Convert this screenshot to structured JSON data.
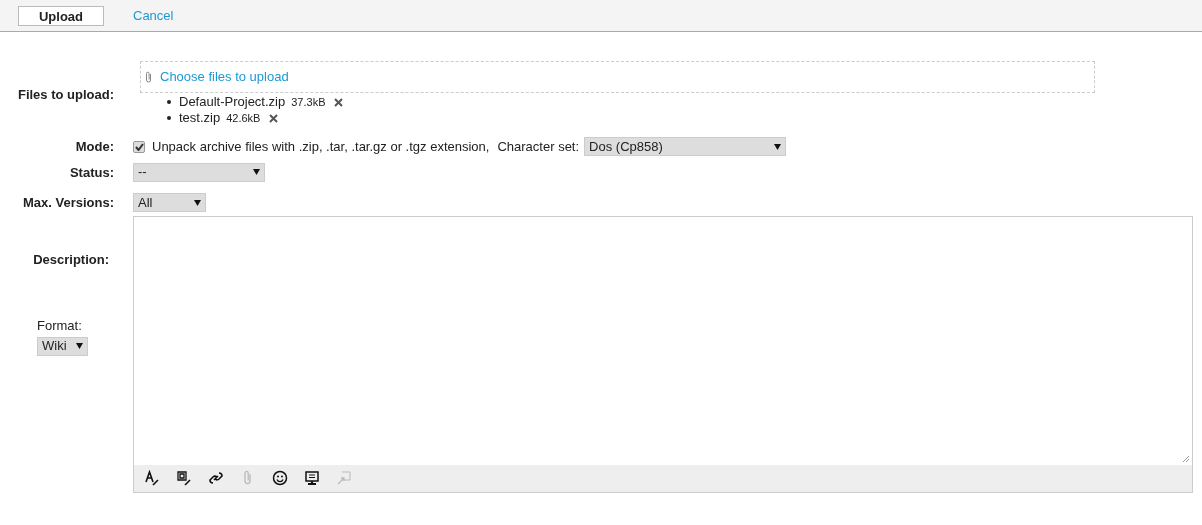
{
  "header": {
    "buttons": [
      {
        "label": "Upload",
        "kind": "button"
      },
      {
        "label": "Cancel",
        "kind": "link"
      }
    ]
  },
  "files": {
    "label": "Files to upload:",
    "chooser": "Choose files to upload",
    "items": [
      {
        "name": "Default-Project.zip",
        "size": "37.3kB"
      },
      {
        "name": "test.zip",
        "size": "42.6kB"
      }
    ]
  },
  "mode": {
    "label": "Mode:",
    "checked": true,
    "text": "Unpack archive files with .zip, .tar, .tar.gz or .tgz extension,",
    "charset_label": "Character set:",
    "charset": "Dos (Cp858)"
  },
  "status": {
    "label": "Status:",
    "value": "--"
  },
  "max_versions": {
    "label": "Max. Versions:",
    "value": "All"
  },
  "description": {
    "label": "Description:",
    "format_label": "Format:",
    "format": "Wiki",
    "toolbar": [
      {
        "kind": "text",
        "disabled": false
      },
      {
        "kind": "box",
        "disabled": false
      },
      {
        "kind": "link",
        "disabled": false
      },
      {
        "kind": "clip",
        "disabled": true
      },
      {
        "kind": "smile",
        "disabled": false
      },
      {
        "kind": "monitor",
        "disabled": false
      },
      {
        "kind": "resize",
        "disabled": true
      }
    ]
  }
}
